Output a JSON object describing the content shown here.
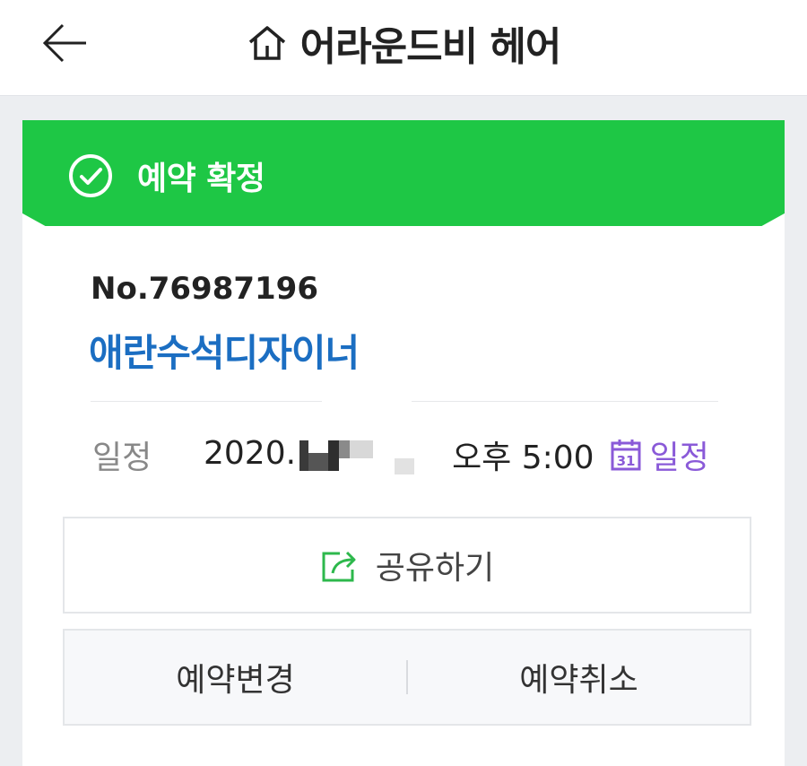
{
  "header": {
    "title": "어라운드비 헤어"
  },
  "banner": {
    "status": "예약 확정",
    "color": "#1ec745"
  },
  "reservation": {
    "number": "No.76987196",
    "designer": "애란수석디자이너",
    "schedule_label": "일정",
    "date_prefix": "2020.",
    "time": "오후 5:00",
    "calendar_link": "일정"
  },
  "actions": {
    "share": "공유하기",
    "change": "예약변경",
    "cancel": "예약취소"
  },
  "icons": {
    "back": "arrow-left-icon",
    "shop": "home-icon",
    "status": "check-circle-icon",
    "calendar": "calendar-icon",
    "share": "share-icon"
  },
  "colors": {
    "accent_green": "#1ec745",
    "designer_blue": "#1b6ec2",
    "calendar_purple": "#8a5ad8"
  }
}
